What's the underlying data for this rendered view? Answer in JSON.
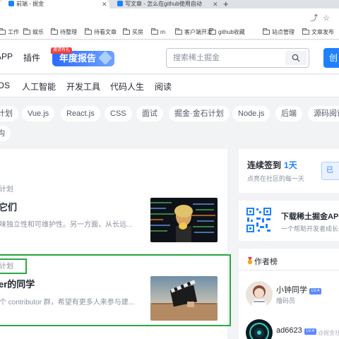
{
  "browser": {
    "tabs": [
      {
        "title": "前端 - 掘金",
        "active": true
      },
      {
        "title": "写文章 - 怎么在github使用自动",
        "active": false
      }
    ],
    "bookmarks": [
      "工作",
      "娱乐",
      "待整理",
      "待看文章",
      "买房",
      "rn",
      "客户端开发",
      "github收藏",
      "站点管理",
      "文章发布"
    ]
  },
  "header": {
    "nav": [
      "APP",
      "插件"
    ],
    "promo_badge": "邀请有礼",
    "promo_label": "年度报告",
    "search_placeholder": "搜索稀土掘金",
    "create_label": "创"
  },
  "categories": [
    "iOS",
    "人工智能",
    "开发工具",
    "代码人生",
    "阅读"
  ],
  "tags": {
    "row1": [
      "计划",
      "Vue.js",
      "React.js",
      "CSS",
      "面试",
      "掘金·金石计划",
      "Node.js",
      "后端",
      "源码阅读"
    ],
    "row2": [
      "构"
    ]
  },
  "feed": {
    "articles": [
      {
        "meta": "计划",
        "title": "它们",
        "abstract": "味独立性和可维护性。另一方面，从长远..."
      },
      {
        "meta": "计划",
        "title": "er的同学",
        "abstract": "个 contributor 群，希望有更多人来参与建..."
      }
    ]
  },
  "sidebar": {
    "checkin": {
      "title": "连续签到",
      "days": "1天",
      "subtitle": "点亮在社区的每一天",
      "button": "已"
    },
    "app": {
      "title": "下载稀土掘金APP",
      "subtitle": "一个帮助开发者成长"
    },
    "authors": {
      "title": "作者榜",
      "list": [
        {
          "name": "小钟同学",
          "level": "LV.4",
          "role": "撸码员"
        },
        {
          "name": "ad6623",
          "level": "LV.4",
          "role": ""
        }
      ]
    }
  },
  "watermark": "@掘金社区",
  "colors": {
    "brand": "#1e80ff",
    "highlight": "#2ea843"
  }
}
